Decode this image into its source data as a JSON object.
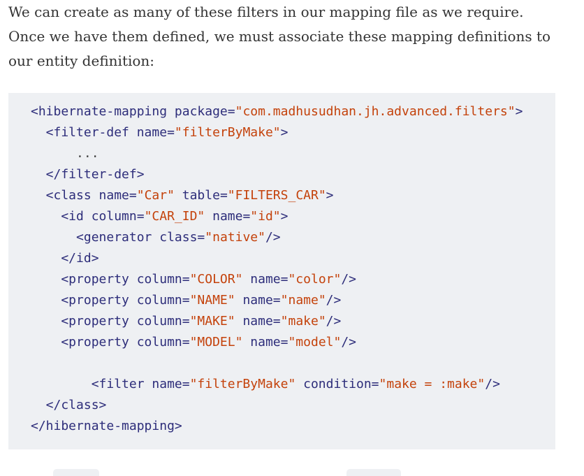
{
  "paragraph": "We can create as many of these filters in our mapping file as we require. Once we have them defined, we must associate these mapping definitions to our entity definition:",
  "code": {
    "lines": [
      [
        {
          "t": "tag",
          "v": "<hibernate-mapping "
        },
        {
          "t": "attr",
          "v": "package="
        },
        {
          "t": "val",
          "v": "\"com.madhusudhan.jh.advanced.filters\""
        },
        {
          "t": "tag",
          "v": ">"
        }
      ],
      [
        {
          "t": "tag",
          "v": "  <filter-def "
        },
        {
          "t": "attr",
          "v": "name="
        },
        {
          "t": "val",
          "v": "\"filterByMake\""
        },
        {
          "t": "tag",
          "v": ">"
        }
      ],
      [
        {
          "t": "plain",
          "v": "      ..."
        }
      ],
      [
        {
          "t": "tag",
          "v": "  </filter-def>"
        }
      ],
      [
        {
          "t": "tag",
          "v": "  <class "
        },
        {
          "t": "attr",
          "v": "name="
        },
        {
          "t": "val",
          "v": "\"Car\""
        },
        {
          "t": "attr",
          "v": " table="
        },
        {
          "t": "val",
          "v": "\"FILTERS_CAR\""
        },
        {
          "t": "tag",
          "v": ">"
        }
      ],
      [
        {
          "t": "tag",
          "v": "    <id "
        },
        {
          "t": "attr",
          "v": "column="
        },
        {
          "t": "val",
          "v": "\"CAR_ID\""
        },
        {
          "t": "attr",
          "v": " name="
        },
        {
          "t": "val",
          "v": "\"id\""
        },
        {
          "t": "tag",
          "v": ">"
        }
      ],
      [
        {
          "t": "tag",
          "v": "      <generator "
        },
        {
          "t": "attr",
          "v": "class="
        },
        {
          "t": "val",
          "v": "\"native\""
        },
        {
          "t": "tag",
          "v": "/>"
        }
      ],
      [
        {
          "t": "tag",
          "v": "    </id>"
        }
      ],
      [
        {
          "t": "tag",
          "v": "    <property "
        },
        {
          "t": "attr",
          "v": "column="
        },
        {
          "t": "val",
          "v": "\"COLOR\""
        },
        {
          "t": "attr",
          "v": " name="
        },
        {
          "t": "val",
          "v": "\"color\""
        },
        {
          "t": "tag",
          "v": "/>"
        }
      ],
      [
        {
          "t": "tag",
          "v": "    <property "
        },
        {
          "t": "attr",
          "v": "column="
        },
        {
          "t": "val",
          "v": "\"NAME\""
        },
        {
          "t": "attr",
          "v": " name="
        },
        {
          "t": "val",
          "v": "\"name\""
        },
        {
          "t": "tag",
          "v": "/>"
        }
      ],
      [
        {
          "t": "tag",
          "v": "    <property "
        },
        {
          "t": "attr",
          "v": "column="
        },
        {
          "t": "val",
          "v": "\"MAKE\""
        },
        {
          "t": "attr",
          "v": " name="
        },
        {
          "t": "val",
          "v": "\"make\""
        },
        {
          "t": "tag",
          "v": "/>"
        }
      ],
      [
        {
          "t": "tag",
          "v": "    <property "
        },
        {
          "t": "attr",
          "v": "column="
        },
        {
          "t": "val",
          "v": "\"MODEL\""
        },
        {
          "t": "attr",
          "v": " name="
        },
        {
          "t": "val",
          "v": "\"model\""
        },
        {
          "t": "tag",
          "v": "/>"
        }
      ],
      [],
      [
        {
          "t": "tag",
          "v": "        <filter "
        },
        {
          "t": "attr",
          "v": "name="
        },
        {
          "t": "val",
          "v": "\"filterByMake\""
        },
        {
          "t": "attr",
          "v": " condition="
        },
        {
          "t": "val",
          "v": "\"make = :make\""
        },
        {
          "t": "tag",
          "v": "/>"
        }
      ],
      [
        {
          "t": "tag",
          "v": "  </class>"
        }
      ],
      [
        {
          "t": "tag",
          "v": "</hibernate-mapping>"
        }
      ]
    ]
  },
  "colors": {
    "text": "#333333",
    "code_background": "#eef0f3",
    "code_tag": "#2d2d7a",
    "code_value": "#c4420b"
  }
}
